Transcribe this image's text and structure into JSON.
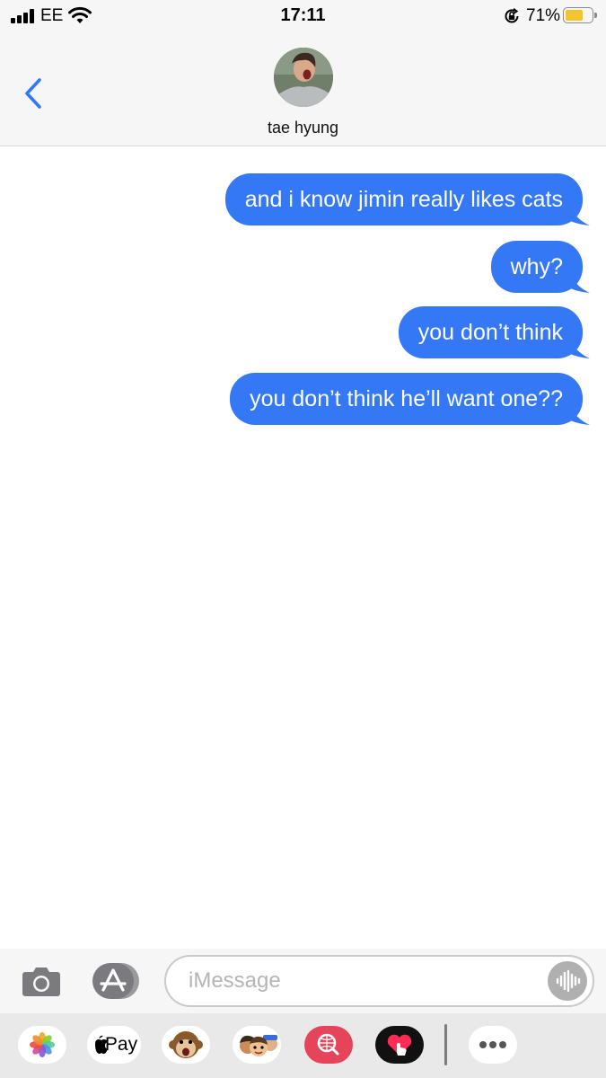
{
  "status_bar": {
    "carrier": "EE",
    "time": "17:11",
    "battery_percent": "71%",
    "battery_level": 0.71,
    "battery_color": "#f4c430"
  },
  "header": {
    "contact_name": "tae hyung",
    "back_icon": "chevron-left-icon",
    "accent_color": "#3478f6"
  },
  "messages": [
    {
      "from": "me",
      "text": "and i know jimin really likes cats"
    },
    {
      "from": "me",
      "text": "why?"
    },
    {
      "from": "me",
      "text": "you don’t think"
    },
    {
      "from": "me",
      "text": "you don’t think he’ll want one??"
    }
  ],
  "input_bar": {
    "placeholder": "iMessage",
    "camera_icon": "camera-icon",
    "appstore_icon": "app-store-icon",
    "audio_icon": "audio-waveform-icon"
  },
  "app_drawer": {
    "apps": [
      {
        "icon": "photos-icon"
      },
      {
        "icon": "apple-pay-icon",
        "label": "Pay"
      },
      {
        "icon": "animoji-monkey-icon"
      },
      {
        "icon": "memoji-stickers-icon"
      },
      {
        "icon": "image-search-icon"
      },
      {
        "icon": "digital-touch-icon"
      },
      {
        "icon": "more-apps-icon"
      }
    ]
  },
  "colors": {
    "bubble": "#3478f6",
    "bar_background": "#f6f6f6",
    "drawer_background": "#e9e9e9"
  }
}
